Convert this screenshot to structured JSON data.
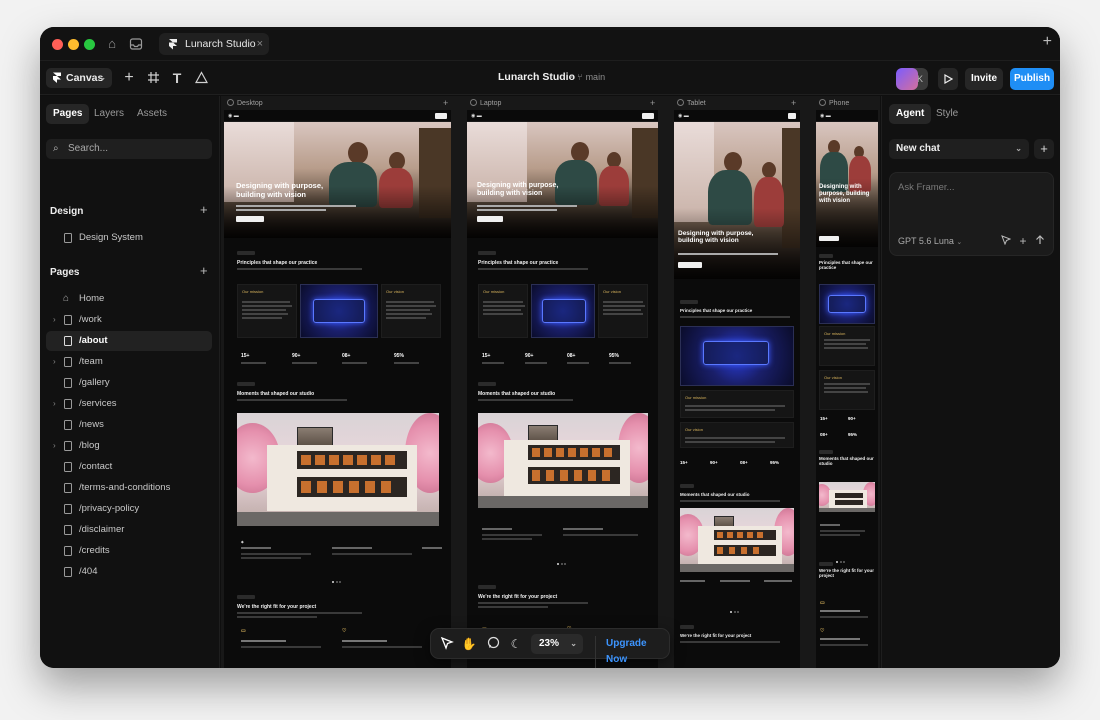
{
  "window": {
    "tab_title": "Lunarch Studio"
  },
  "toolbar": {
    "canvas_label": "Canvas",
    "project_name": "Lunarch Studio",
    "branch": "main",
    "avatar_initial": "K",
    "invite_label": "Invite",
    "publish_label": "Publish"
  },
  "left_panel": {
    "tabs": [
      "Pages",
      "Layers",
      "Assets"
    ],
    "search_placeholder": "Search...",
    "design_section": {
      "title": "Design",
      "items": [
        "Design System"
      ]
    },
    "pages_section": {
      "title": "Pages",
      "items": [
        "Home",
        "/work",
        "/about",
        "/team",
        "/gallery",
        "/services",
        "/news",
        "/blog",
        "/contact",
        "/terms-and-conditions",
        "/privacy-policy",
        "/disclaimer",
        "/credits",
        "/404"
      ],
      "expandable": [
        "/work",
        "/team",
        "/services",
        "/blog"
      ],
      "selected": "/about"
    }
  },
  "canvas": {
    "frames": [
      "Desktop",
      "Laptop",
      "Tablet",
      "Phone"
    ],
    "preview": {
      "hero_heading_line1": "Designing with purpose,",
      "hero_heading_line2": "building with vision",
      "principles_heading": "Principles that shape our practice",
      "mission_label": "Our mission",
      "vision_label": "Our vision",
      "stats": [
        "15+",
        "90+",
        "08+",
        "95%"
      ],
      "moments_heading": "Moments that shaped our studio",
      "fit_heading": "We're the right fit for your project"
    }
  },
  "bottom_bar": {
    "zoom": "23%",
    "upgrade_label": "Upgrade Now"
  },
  "right_panel": {
    "tabs": [
      "Agent",
      "Style"
    ],
    "chat_select": "New chat",
    "input_placeholder": "Ask Framer...",
    "model": "GPT 5.6 Luna"
  },
  "colors": {
    "accent": "#1f8ef5",
    "upgrade": "#3d95ff",
    "background": "#0f0f0f"
  }
}
